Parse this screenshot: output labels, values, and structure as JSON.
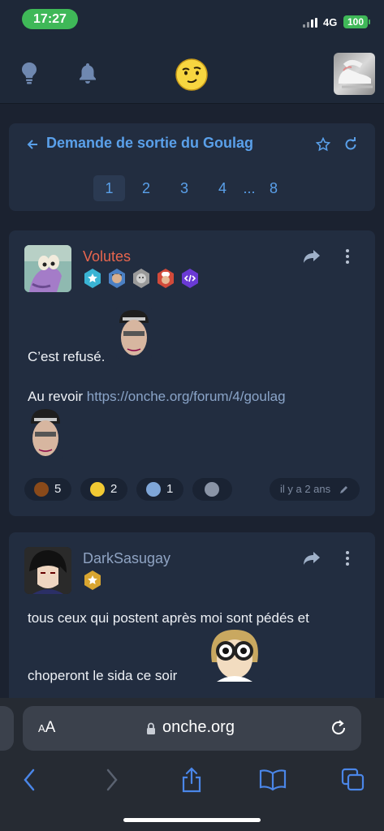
{
  "status": {
    "time": "17:27",
    "network": "4G",
    "battery": "100"
  },
  "nav": {
    "icons": [
      "lightbulb-icon",
      "bell-icon",
      "onche-smiley-logo",
      "user-avatar"
    ]
  },
  "topic": {
    "title": "Demande de sortie du Goulag",
    "pages": [
      "1",
      "2",
      "3",
      "4",
      "...",
      "8"
    ],
    "current_page": "1"
  },
  "posts": [
    {
      "username": "Volutes",
      "username_color": "#e8664e",
      "lines": [
        "C’est refusé.",
        "Au revoir"
      ],
      "link": "https://onche.org/forum/4/goulag",
      "reactions": [
        {
          "icon": "poop-emoji",
          "count": "5"
        },
        {
          "icon": "crying-laughing-emoji",
          "count": "2"
        },
        {
          "icon": "sticker-emoji",
          "count": "1"
        },
        {
          "icon": "add-reaction-icon",
          "count": ""
        }
      ],
      "timestamp": "il y a 2 ans"
    },
    {
      "username": "DarkSasugay",
      "username_color": "#8fa3c2",
      "lines": [
        "tous ceux qui postent après moi sont pédés et",
        "choperont le sida ce soir"
      ]
    }
  ],
  "browser": {
    "aa": "AA",
    "domain": "onche.org"
  },
  "colors": {
    "accent": "#5aa0ea",
    "card": "#222d40",
    "background": "#1b2230"
  }
}
